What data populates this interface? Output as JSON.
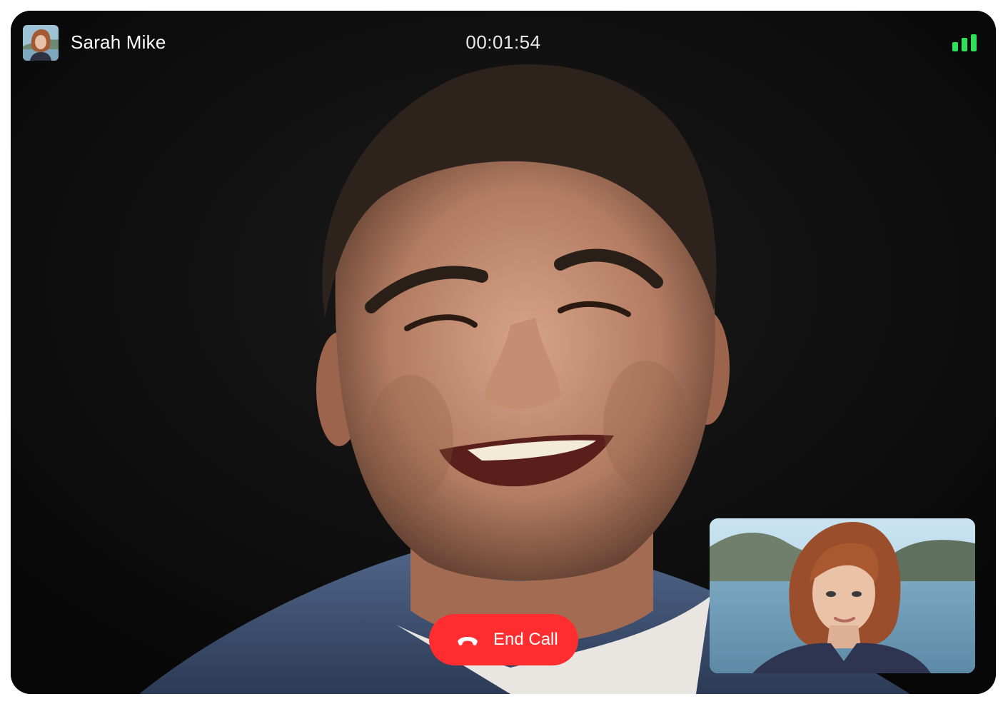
{
  "call": {
    "caller_name": "Sarah Mike",
    "timer": "00:01:54",
    "signal_level": 1.0
  },
  "controls": {
    "end_call_label": "End Call"
  },
  "icons": {
    "end_call": "phone-hangup-icon",
    "signal": "signal-strength-icon"
  },
  "colors": {
    "end_call_background": "#ff2d2f",
    "signal_bars": "#2ee05a",
    "video_background": "#0c0c0c",
    "text": "#ffffff"
  }
}
